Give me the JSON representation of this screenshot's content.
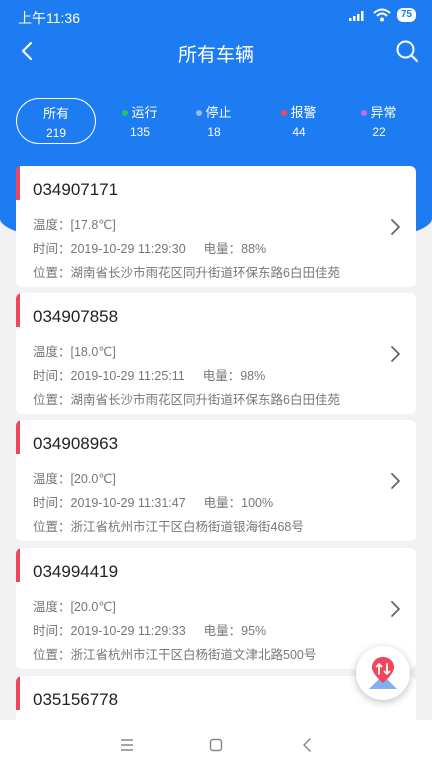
{
  "status_bar": {
    "time": "上午11:36",
    "battery": "75"
  },
  "nav": {
    "title": "所有车辆"
  },
  "filters": [
    {
      "label": "所有",
      "count": "219",
      "color": ""
    },
    {
      "label": "运行",
      "count": "135",
      "color": "#27c26b"
    },
    {
      "label": "停止",
      "count": "18",
      "color": "#9ab8dd"
    },
    {
      "label": "报警",
      "count": "44",
      "color": "#f0455c"
    },
    {
      "label": "异常",
      "count": "22",
      "color": "#c36be8"
    }
  ],
  "vehicles": [
    {
      "id": "034907171",
      "temp": "温度：[17.8℃]",
      "time": "时间：2019-10-29 11:29:30",
      "power": "电量：88%",
      "location": "位置：湖南省长沙市雨花区同升街道环保东路6白田佳苑"
    },
    {
      "id": "034907858",
      "temp": "温度：[18.0℃]",
      "time": "时间：2019-10-29 11:25:11",
      "power": "电量：98%",
      "location": "位置：湖南省长沙市雨花区同升街道环保东路6白田佳苑"
    },
    {
      "id": "034908963",
      "temp": "温度：[20.0℃]",
      "time": "时间：2019-10-29 11:31:47",
      "power": "电量：100%",
      "location": "位置：浙江省杭州市江干区白杨街道银海街468号"
    },
    {
      "id": "034994419",
      "temp": "温度：[20.0℃]",
      "time": "时间：2019-10-29 11:29:33",
      "power": "电量：95%",
      "location": "位置：浙江省杭州市江干区白杨街道文津北路500号"
    },
    {
      "id": "035156778",
      "temp": "",
      "time": "",
      "power": "",
      "location": ""
    }
  ],
  "colors": {
    "brand": "#1e7cf2",
    "alert_bar": "#f0455c"
  },
  "icons": {
    "back": "chevron-left-icon",
    "search": "search-icon",
    "fab": "map-marker-sort-icon"
  }
}
